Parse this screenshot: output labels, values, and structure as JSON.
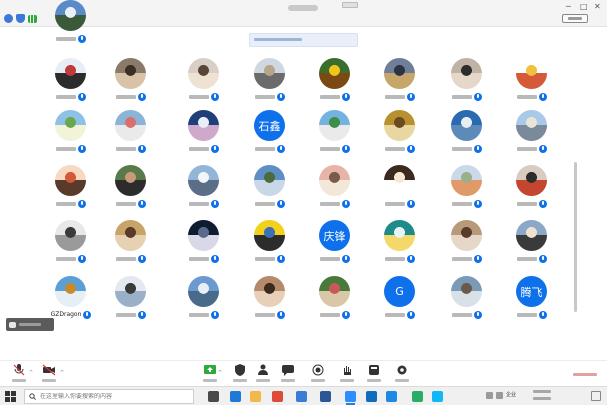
{
  "window": {
    "title": "",
    "view_toggle_label": ""
  },
  "banner": {
    "text": ""
  },
  "participants": [
    {
      "name": "",
      "avatar": "photo-skier",
      "colors": [
        "#e8eef5",
        "#c23b3b",
        "#2c2c2c"
      ]
    },
    {
      "name": "",
      "avatar": "photo-person",
      "colors": [
        "#8a7a6a",
        "#3b2e25",
        "#d9c3a8"
      ]
    },
    {
      "name": "",
      "avatar": "photo-person",
      "colors": [
        "#d8d0c8",
        "#5a4638",
        "#f0e2d2"
      ]
    },
    {
      "name": "",
      "avatar": "photo-landscape",
      "colors": [
        "#cfd8e0",
        "#b7a58a",
        "#6b6b6b"
      ]
    },
    {
      "name": "",
      "avatar": "photo-sunflower",
      "colors": [
        "#3b6e2e",
        "#f2c51a",
        "#7a4a12"
      ]
    },
    {
      "name": "",
      "avatar": "photo-landscape",
      "colors": [
        "#6f7f9a",
        "#2b3445",
        "#c7a66b"
      ]
    },
    {
      "name": "",
      "avatar": "photo-person",
      "colors": [
        "#bfb3a6",
        "#2c2c2c",
        "#e6d8c8"
      ]
    },
    {
      "name": "",
      "avatar": "photo-cartoon",
      "colors": [
        "#ffffff",
        "#f0c040",
        "#d65a3a"
      ]
    },
    {
      "name": "",
      "avatar": "photo-landscape",
      "colors": [
        "#8ec1e8",
        "#6aa84f",
        "#f3f3d8"
      ]
    },
    {
      "name": "",
      "avatar": "photo-landscape",
      "colors": [
        "#8ab4d8",
        "#d9706a",
        "#eaeaea"
      ]
    },
    {
      "name": "",
      "avatar": "photo-flower",
      "colors": [
        "#1f3f7a",
        "#e9eef8",
        "#cfa9c9"
      ]
    },
    {
      "name": "",
      "avatar": "initials",
      "initials": "石鑫",
      "colors": [
        "#0e71eb"
      ]
    },
    {
      "name": "",
      "avatar": "photo-landscape",
      "colors": [
        "#74b2e0",
        "#3f8f4a",
        "#eaeaea"
      ]
    },
    {
      "name": "",
      "avatar": "photo-landscape",
      "colors": [
        "#b8902f",
        "#6a4a1f",
        "#e8d7a0"
      ]
    },
    {
      "name": "",
      "avatar": "photo-landscape",
      "colors": [
        "#2a6ab0",
        "#e8eef4",
        "#5d8ab8"
      ]
    },
    {
      "name": "",
      "avatar": "photo-landscape",
      "colors": [
        "#a9c9e8",
        "#e9e4d8",
        "#7a8a9a"
      ]
    },
    {
      "name": "",
      "avatar": "photo-cartoon",
      "colors": [
        "#f6d9c0",
        "#d4583a",
        "#5a3a2a"
      ]
    },
    {
      "name": "",
      "avatar": "photo-person",
      "colors": [
        "#5a7a4a",
        "#c89a7a",
        "#2c2c2c"
      ]
    },
    {
      "name": "",
      "avatar": "photo-landscape",
      "colors": [
        "#93b6d8",
        "#f1f4f8",
        "#5a6e88"
      ]
    },
    {
      "name": "",
      "avatar": "photo-landscape",
      "colors": [
        "#5d8fc6",
        "#4d6b3a",
        "#c9d8e8"
      ]
    },
    {
      "name": "",
      "avatar": "photo-group",
      "colors": [
        "#e8b3a8",
        "#7a5a4a",
        "#f3e8d8"
      ]
    },
    {
      "name": "",
      "avatar": "photo-cartoon",
      "colors": [
        "#3b2a1e",
        "#f6e7d4",
        "#ffffff"
      ]
    },
    {
      "name": "",
      "avatar": "photo-landscape",
      "colors": [
        "#c9d9e9",
        "#9ab08a",
        "#e09a6a"
      ]
    },
    {
      "name": "",
      "avatar": "photo-person",
      "colors": [
        "#d8ccc0",
        "#2c2c2c",
        "#c4462e"
      ]
    },
    {
      "name": "",
      "avatar": "photo-person",
      "colors": [
        "#e8e8e8",
        "#3a3a3a",
        "#9a9a9a"
      ]
    },
    {
      "name": "",
      "avatar": "photo-group",
      "colors": [
        "#c9a46a",
        "#5a3a2a",
        "#e6d2b0"
      ]
    },
    {
      "name": "",
      "avatar": "photo-night",
      "colors": [
        "#0f1b30",
        "#5a6a8a",
        "#d8d8e8"
      ]
    },
    {
      "name": "",
      "avatar": "photo-cartoon",
      "colors": [
        "#f3d11a",
        "#3b6fb6",
        "#2c2c2c"
      ]
    },
    {
      "name": "",
      "avatar": "initials",
      "initials": "庆锋",
      "colors": [
        "#0e71eb"
      ]
    },
    {
      "name": "",
      "avatar": "photo-bulb",
      "colors": [
        "#1e8a8a",
        "#e8f4f4",
        "#f3d96a"
      ]
    },
    {
      "name": "",
      "avatar": "photo-hands",
      "colors": [
        "#b89a7a",
        "#5a3a2a",
        "#e6d8c8"
      ]
    },
    {
      "name": "",
      "avatar": "photo-person",
      "colors": [
        "#8aa8c8",
        "#f0e0d0",
        "#3a3a3a"
      ]
    },
    {
      "name": "GZDragon",
      "avatar": "photo-tower",
      "colors": [
        "#5aa0d8",
        "#c88a2a",
        "#e6eef6"
      ]
    },
    {
      "name": "",
      "avatar": "photo-landscape",
      "colors": [
        "#e3e9ef",
        "#3a3a3a",
        "#9ab0c8"
      ]
    },
    {
      "name": "",
      "avatar": "photo-landscape",
      "colors": [
        "#6a9ad0",
        "#e8eef4",
        "#4a6a8a"
      ]
    },
    {
      "name": "",
      "avatar": "photo-person",
      "colors": [
        "#b48a6a",
        "#3a2a1e",
        "#e8d0b8"
      ]
    },
    {
      "name": "",
      "avatar": "photo-landscape",
      "colors": [
        "#4a7a3a",
        "#c8585a",
        "#d8c8a8"
      ]
    },
    {
      "name": "",
      "avatar": "initials",
      "initials": "G",
      "colors": [
        "#0e71eb"
      ]
    },
    {
      "name": "",
      "avatar": "photo-landscape",
      "colors": [
        "#7a9ab8",
        "#6a5a4a",
        "#d8e0e8"
      ]
    },
    {
      "name": "",
      "avatar": "initials",
      "initials": "腾飞",
      "colors": [
        "#0e71eb"
      ]
    },
    {
      "name": "",
      "avatar": "photo-landscape",
      "colors": [
        "#5a8ac8",
        "#e8f0f8",
        "#3a5a3a"
      ]
    }
  ],
  "chat": {
    "label": ""
  },
  "toolbar": {
    "tools": [
      {
        "label": "",
        "icon": "microphone-muted-icon"
      },
      {
        "label": "",
        "icon": "video-off-icon"
      },
      {
        "label": "",
        "icon": "share-screen-icon"
      },
      {
        "label": "",
        "icon": "security-icon"
      },
      {
        "label": "",
        "icon": "participants-icon"
      },
      {
        "label": "",
        "icon": "chat-icon"
      },
      {
        "label": "",
        "icon": "record-icon"
      },
      {
        "label": "",
        "icon": "raise-hand-icon"
      },
      {
        "label": "",
        "icon": "app-icon"
      },
      {
        "label": "",
        "icon": "settings-icon"
      }
    ],
    "end_label": ""
  },
  "taskbar": {
    "search_placeholder": "在这里输入你要搜索的内容",
    "apps": [
      {
        "icon": "task-view-icon",
        "color": "#4a4a4a"
      },
      {
        "icon": "edge-icon",
        "color": "#1f7ad6"
      },
      {
        "icon": "folder-icon",
        "color": "#f2b84b"
      },
      {
        "icon": "chrome-icon",
        "color": "#de4b37"
      },
      {
        "icon": "store-icon",
        "color": "#3a7bd5"
      },
      {
        "icon": "word-icon",
        "color": "#2b5797"
      },
      {
        "icon": "meeting-app-icon",
        "color": "#2d8cff"
      },
      {
        "icon": "outlook-icon",
        "color": "#0f6cbd"
      },
      {
        "icon": "email-icon",
        "color": "#1e88e5"
      },
      {
        "icon": "wechat-icon",
        "color": "#2aae67"
      },
      {
        "icon": "chat-app-icon",
        "color": "#12b7f5"
      }
    ],
    "lang": "企业",
    "time": "",
    "date": ""
  }
}
